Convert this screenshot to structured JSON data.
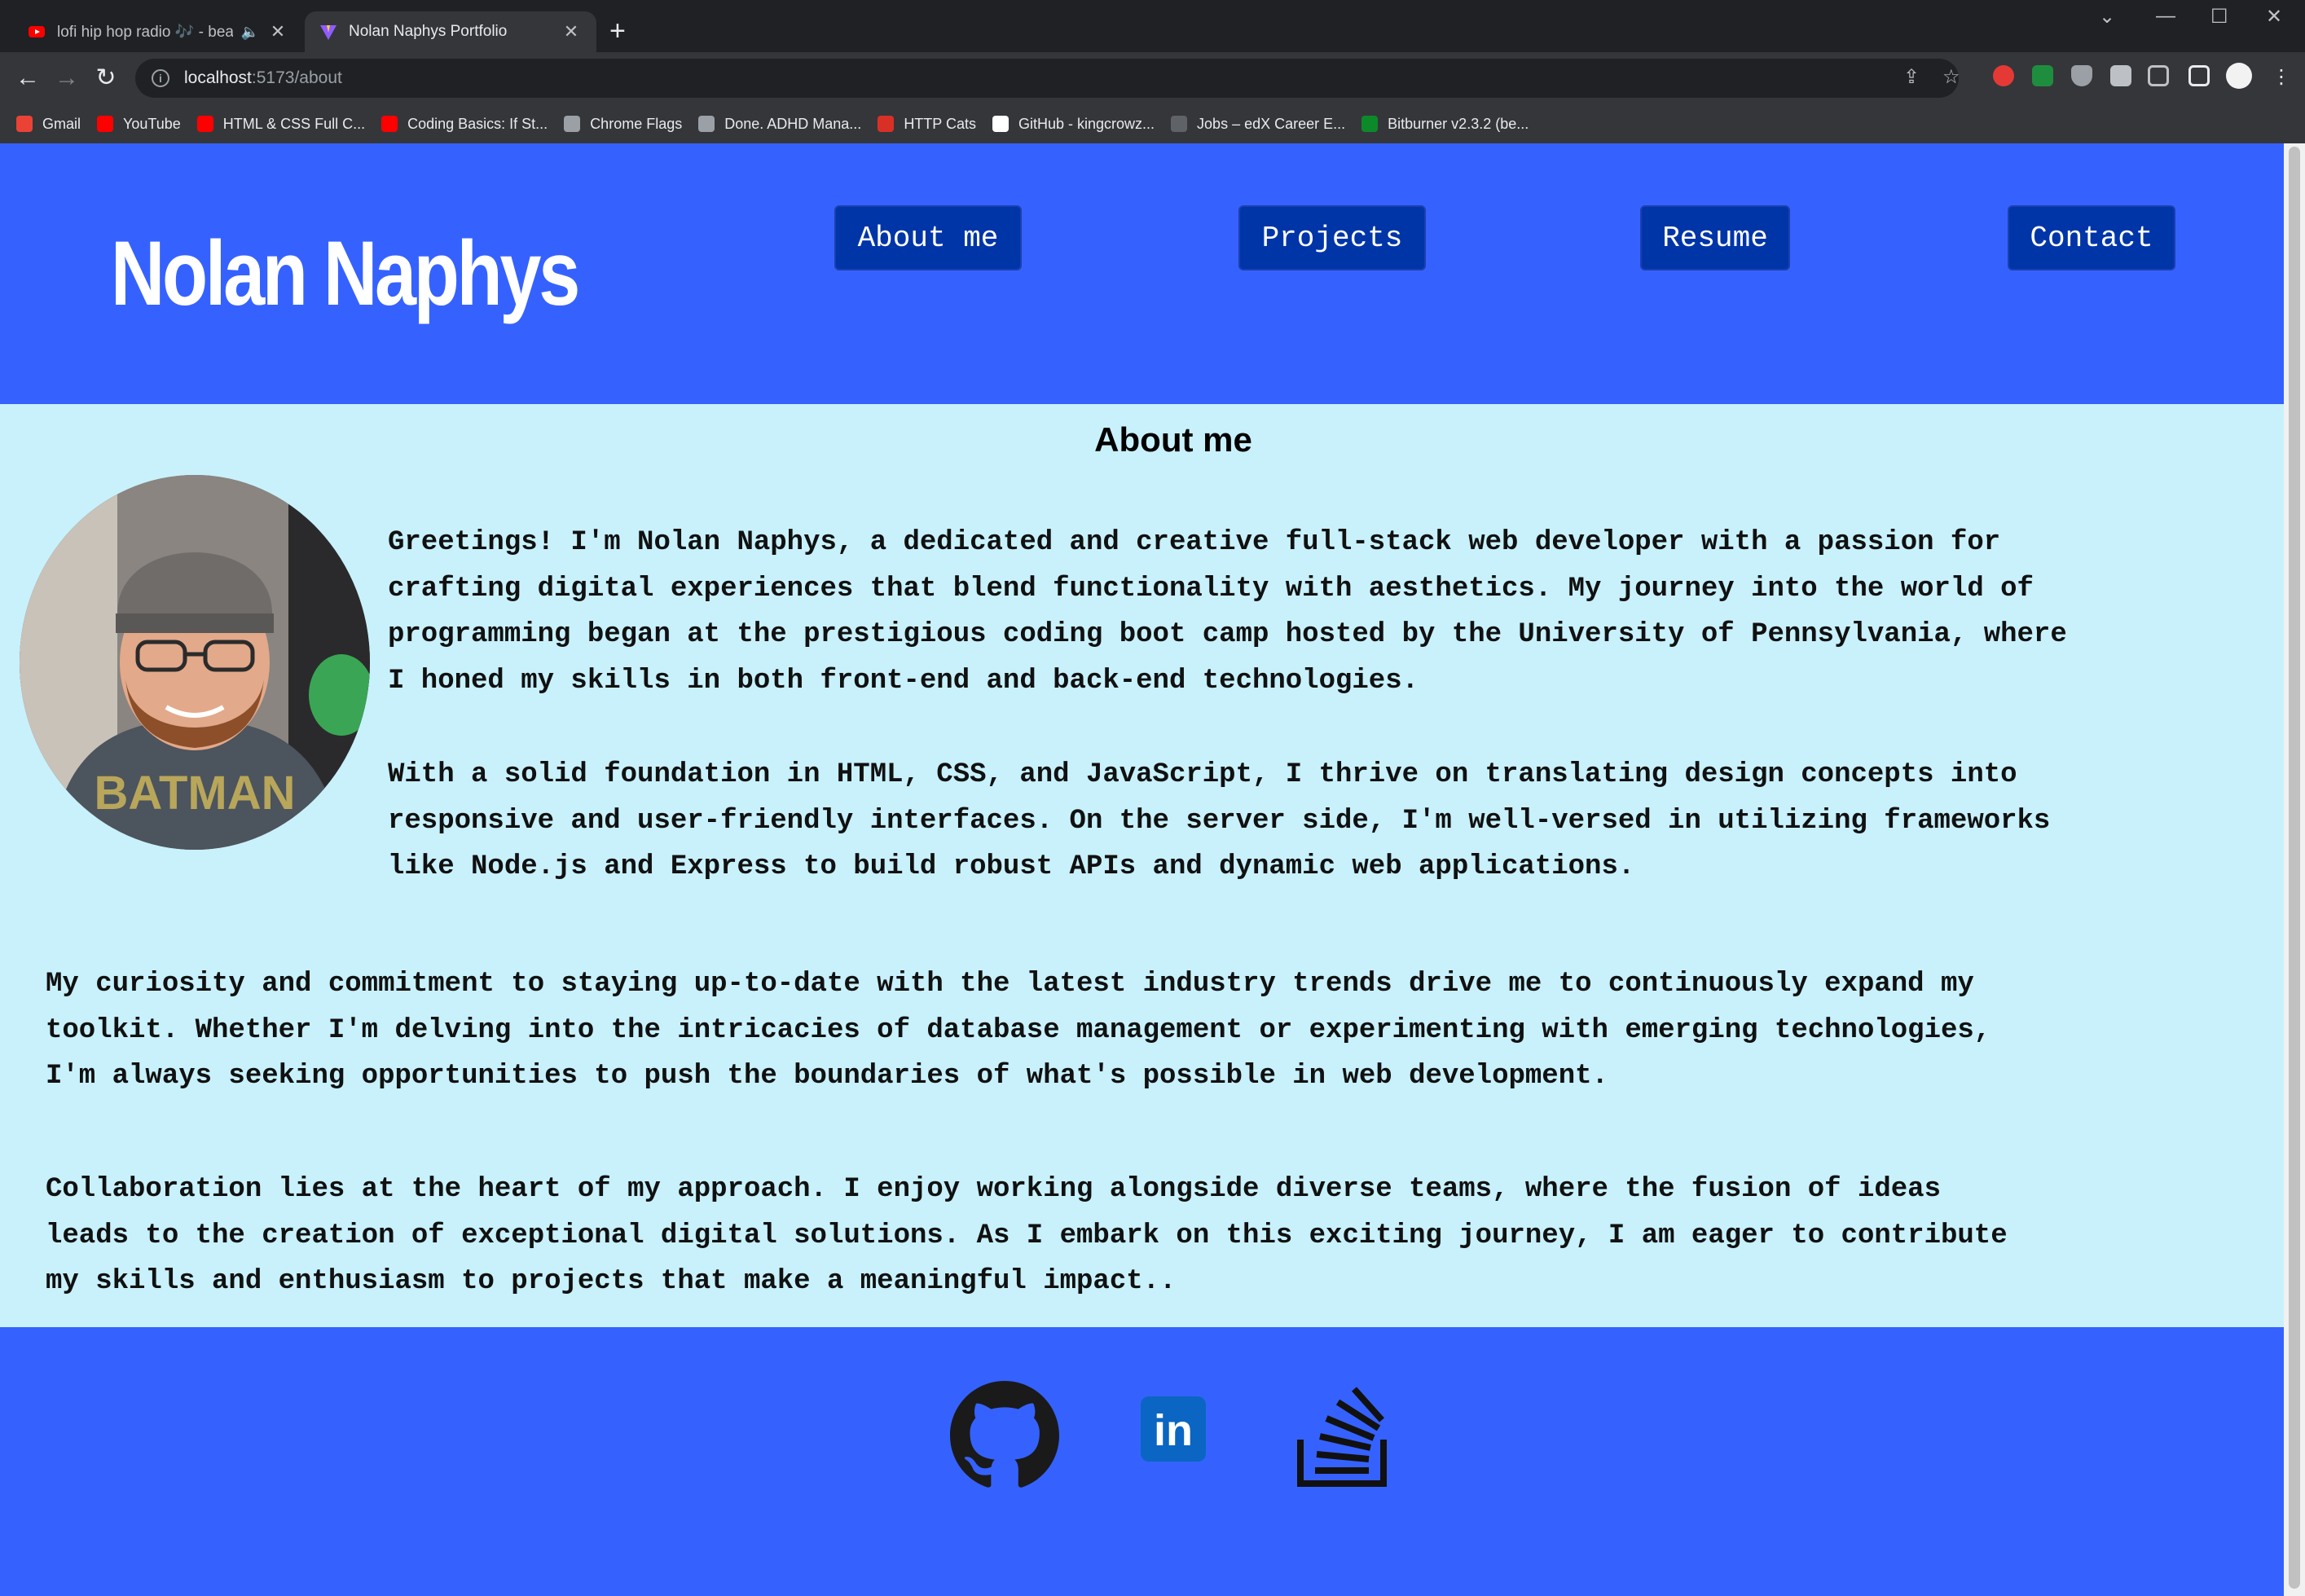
{
  "browser": {
    "tabs": [
      {
        "title": "lofi hip hop radio 🎶 - beats",
        "active": false,
        "audio": true
      },
      {
        "title": "Nolan Naphys Portfolio",
        "active": true,
        "audio": false
      }
    ],
    "new_tab_symbol": "+",
    "url_host": "localhost",
    "url_path": ":5173/about",
    "bookmarks": [
      {
        "label": "Gmail",
        "color": "#ea4335"
      },
      {
        "label": "YouTube",
        "color": "#ff0000"
      },
      {
        "label": "HTML & CSS Full C...",
        "color": "#ff0000"
      },
      {
        "label": "Coding Basics: If St...",
        "color": "#ff0000"
      },
      {
        "label": "Chrome Flags",
        "color": "#9aa0a6"
      },
      {
        "label": "Done. ADHD Mana...",
        "color": "#9aa0a6"
      },
      {
        "label": "HTTP Cats",
        "color": "#d93025"
      },
      {
        "label": "GitHub - kingcrowz...",
        "color": "#ffffff"
      },
      {
        "label": "Jobs – edX Career E...",
        "color": "#5f6368"
      },
      {
        "label": "Bitburner v2.3.2 (be...",
        "color": "#0c8a2a"
      }
    ]
  },
  "site": {
    "brand": "Nolan Naphys",
    "nav": [
      "About me",
      "Projects",
      "Resume",
      "Contact"
    ],
    "colors": {
      "header": "#3562ff",
      "content": "#c8f1fc",
      "nav_button": "#0035a8"
    }
  },
  "about": {
    "title": "About me",
    "paragraphs": [
      [
        "Greetings! I'm Nolan Naphys, a dedicated and creative full-stack web developer with a passion for",
        "crafting digital experiences that blend functionality with aesthetics. My journey into the world of",
        "programming began at the prestigious coding boot camp hosted by the University of Pennsylvania, where",
        "I honed my skills in both front-end and back-end technologies."
      ],
      [
        "With a solid foundation in HTML, CSS, and JavaScript, I thrive on translating design concepts into",
        "responsive and user-friendly interfaces. On the server side, I'm well-versed in utilizing frameworks",
        "like Node.js and Express to build robust APIs and dynamic web applications."
      ],
      [
        "My curiosity and commitment to staying up-to-date with the latest industry trends drive me to continuously expand my",
        "toolkit. Whether I'm delving into the intricacies of database management or experimenting with emerging technologies,",
        "I'm always seeking opportunities to push the boundaries of what's possible in web development."
      ],
      [
        "Collaboration lies at the heart of my approach. I enjoy working alongside diverse teams, where the fusion of ideas",
        "leads to the creation of exceptional digital solutions. As I embark on this exciting journey, I am eager to contribute",
        "my skills and enthusiasm to projects that make a meaningful impact.."
      ]
    ],
    "avatar_shirt_text": "BATMAN"
  },
  "footer": {
    "icons": [
      "github-icon",
      "linkedin-icon",
      "stackoverflow-icon"
    ],
    "linkedin_text": "in"
  }
}
